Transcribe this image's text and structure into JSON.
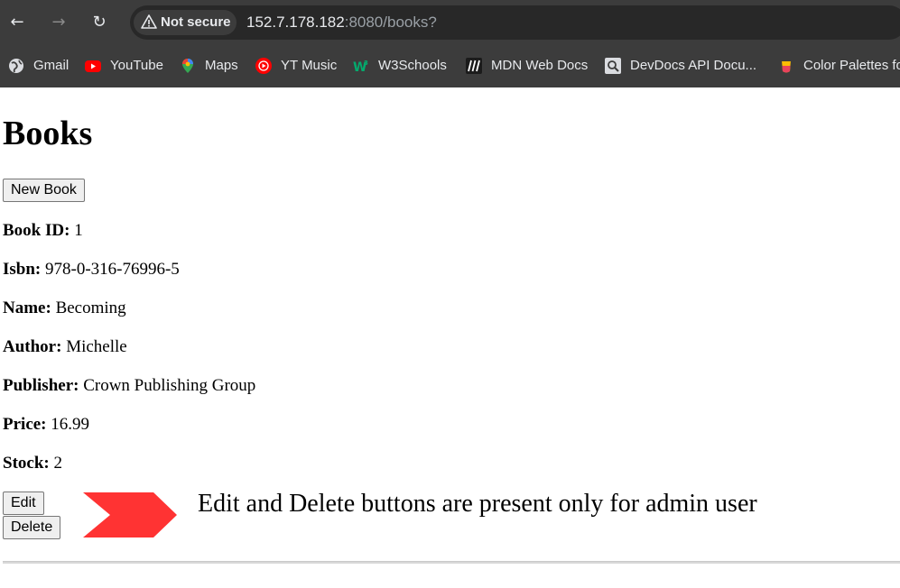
{
  "browser": {
    "url_host": "152.7.178.182",
    "url_rest": ":8080/books?",
    "security_label": "Not secure",
    "bookmarks": [
      {
        "label": "Gmail",
        "icon": "globe-icon"
      },
      {
        "label": "YouTube",
        "icon": "youtube-icon"
      },
      {
        "label": "Maps",
        "icon": "maps-pin-icon"
      },
      {
        "label": "YT Music",
        "icon": "yt-music-icon"
      },
      {
        "label": "W3Schools",
        "icon": "w3schools-icon"
      },
      {
        "label": "MDN Web Docs",
        "icon": "mdn-icon"
      },
      {
        "label": "DevDocs API Docu...",
        "icon": "devdocs-icon"
      },
      {
        "label": "Color Palettes fo",
        "icon": "palette-icon"
      }
    ]
  },
  "page": {
    "title": "Books",
    "new_book_label": "New Book",
    "fields": [
      {
        "label": "Book ID:",
        "value": "1"
      },
      {
        "label": "Isbn:",
        "value": "978-0-316-76996-5"
      },
      {
        "label": "Name:",
        "value": "Becoming"
      },
      {
        "label": "Author:",
        "value": "Michelle"
      },
      {
        "label": "Publisher:",
        "value": "Crown Publishing Group"
      },
      {
        "label": "Price:",
        "value": "16.99"
      },
      {
        "label": "Stock:",
        "value": "2"
      }
    ],
    "edit_label": "Edit",
    "delete_label": "Delete",
    "annotation": "Edit and Delete buttons are present only for admin user",
    "arrow_color": "#ff3333"
  }
}
